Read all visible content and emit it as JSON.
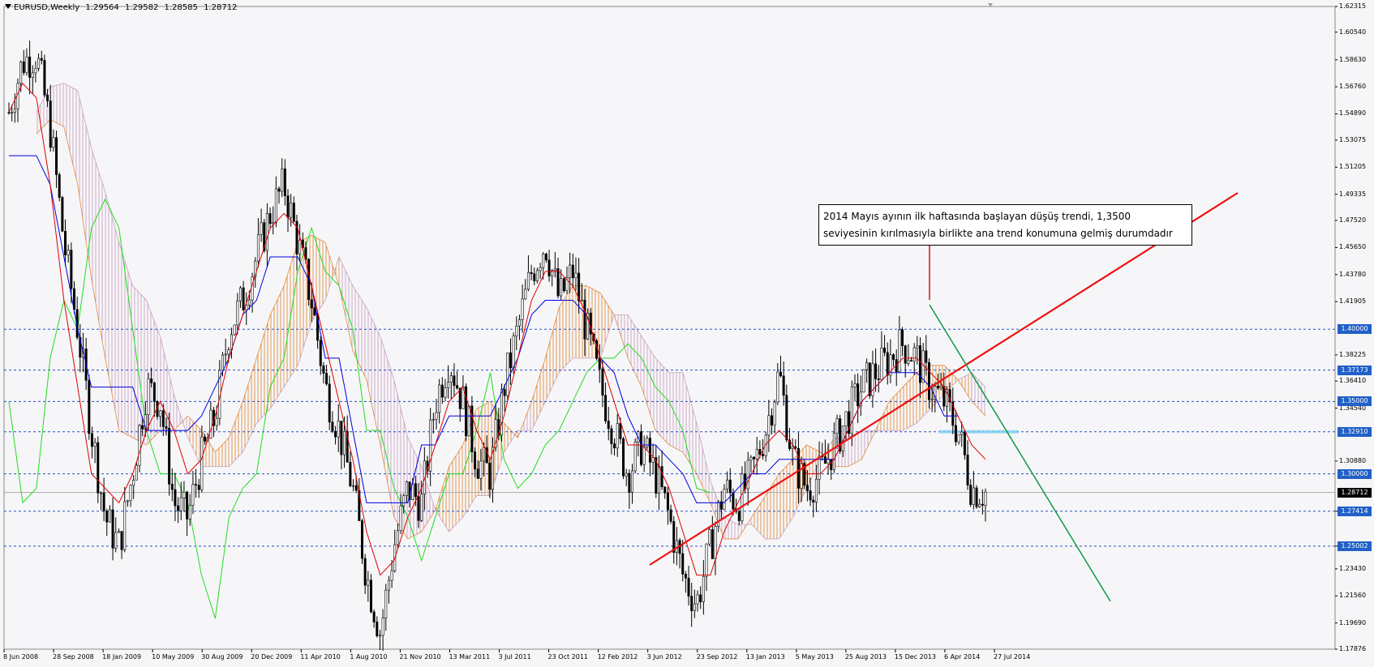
{
  "header": {
    "symbol": "EURUSD,Weekly",
    "open": "1.29564",
    "high": "1.29582",
    "low": "1.28585",
    "close": "1.28712"
  },
  "annotation": {
    "line1": "2014 Mayıs ayının ilk haftasında başlayan düşüş trendi, 1,3500",
    "line2": "seviyesinin kırılmasıyla birlikte ana trend konumuna gelmiş durumdadır"
  },
  "colors": {
    "background": "#f6f6f8",
    "candle": "#000000",
    "tenkan": "#e00000",
    "kijun": "#0000e0",
    "chikou": "#22dd22",
    "kumo_bull": "#e08a3c",
    "kumo_bear": "#c9a0c0",
    "hline": "#2a4fbf",
    "trendline_up": "#ee1111",
    "trendline_down": "#119944",
    "badge": "#2060c8"
  },
  "chart_data": {
    "type": "candlestick",
    "instrument": "EURUSD",
    "timeframe": "Weekly",
    "ylim": [
      1.17876,
      1.62315
    ],
    "y_ticks": [
      "1.62315",
      "1.60540",
      "1.58630",
      "1.56760",
      "1.54890",
      "1.53075",
      "1.51205",
      "1.49335",
      "1.47520",
      "1.45650",
      "1.43780",
      "1.41905",
      "1.38225",
      "1.36410",
      "1.34540",
      "1.30880",
      "1.27415",
      "1.25002",
      "1.23430",
      "1.21560",
      "1.19690",
      "1.17876"
    ],
    "x_ticks": [
      "8 Jun 2008",
      "28 Sep 2008",
      "18 Jan 2009",
      "10 May 2009",
      "30 Aug 2009",
      "20 Dec 2009",
      "11 Apr 2010",
      "1 Aug 2010",
      "21 Nov 2010",
      "13 Mar 2011",
      "3 Jul 2011",
      "23 Oct 2011",
      "12 Feb 2012",
      "3 Jun 2012",
      "23 Sep 2012",
      "13 Jan 2013",
      "5 May 2013",
      "25 Aug 2013",
      "15 Dec 2013",
      "6 Apr 2014",
      "27 Jul 2014"
    ],
    "levels": [
      {
        "label": "1.40000",
        "value": 1.4
      },
      {
        "label": "1.37173",
        "value": 1.37173
      },
      {
        "label": "1.35000",
        "value": 1.35
      },
      {
        "label": "1.32910",
        "value": 1.3291
      },
      {
        "label": "1.30000",
        "value": 1.3
      },
      {
        "label": "1.27414",
        "value": 1.27414
      },
      {
        "label": "1.25002",
        "value": 1.25002
      }
    ],
    "current_price": {
      "label": "1.28712",
      "value": 1.28712
    },
    "path_close": [
      1.55,
      1.585,
      1.59,
      1.54,
      1.46,
      1.4,
      1.33,
      1.27,
      1.25,
      1.3,
      1.36,
      1.35,
      1.28,
      1.27,
      1.31,
      1.34,
      1.4,
      1.42,
      1.45,
      1.48,
      1.5,
      1.46,
      1.42,
      1.36,
      1.33,
      1.29,
      1.23,
      1.19,
      1.25,
      1.29,
      1.28,
      1.35,
      1.38,
      1.35,
      1.31,
      1.3,
      1.36,
      1.4,
      1.44,
      1.46,
      1.42,
      1.44,
      1.4,
      1.36,
      1.33,
      1.3,
      1.32,
      1.3,
      1.27,
      1.23,
      1.21,
      1.25,
      1.29,
      1.28,
      1.3,
      1.33,
      1.37,
      1.31,
      1.29,
      1.3,
      1.32,
      1.34,
      1.36,
      1.37,
      1.38,
      1.39,
      1.38,
      1.36,
      1.35,
      1.33,
      1.29,
      1.287
    ],
    "tenkan": [
      1.55,
      1.57,
      1.56,
      1.5,
      1.42,
      1.36,
      1.3,
      1.29,
      1.28,
      1.3,
      1.33,
      1.35,
      1.33,
      1.3,
      1.31,
      1.34,
      1.38,
      1.41,
      1.44,
      1.47,
      1.48,
      1.47,
      1.43,
      1.39,
      1.35,
      1.31,
      1.26,
      1.23,
      1.24,
      1.27,
      1.29,
      1.32,
      1.35,
      1.36,
      1.33,
      1.31,
      1.34,
      1.38,
      1.42,
      1.44,
      1.44,
      1.43,
      1.41,
      1.38,
      1.35,
      1.32,
      1.32,
      1.31,
      1.29,
      1.26,
      1.23,
      1.23,
      1.26,
      1.28,
      1.3,
      1.32,
      1.33,
      1.32,
      1.3,
      1.3,
      1.31,
      1.33,
      1.35,
      1.36,
      1.37,
      1.38,
      1.38,
      1.37,
      1.36,
      1.34,
      1.32,
      1.31
    ],
    "kijun": [
      1.52,
      1.52,
      1.52,
      1.5,
      1.45,
      1.4,
      1.36,
      1.36,
      1.36,
      1.36,
      1.33,
      1.33,
      1.33,
      1.33,
      1.34,
      1.36,
      1.38,
      1.41,
      1.42,
      1.45,
      1.45,
      1.45,
      1.43,
      1.38,
      1.38,
      1.33,
      1.28,
      1.28,
      1.28,
      1.28,
      1.32,
      1.32,
      1.34,
      1.34,
      1.34,
      1.34,
      1.36,
      1.38,
      1.41,
      1.42,
      1.42,
      1.42,
      1.41,
      1.38,
      1.37,
      1.34,
      1.32,
      1.32,
      1.31,
      1.3,
      1.28,
      1.28,
      1.28,
      1.29,
      1.3,
      1.3,
      1.31,
      1.31,
      1.31,
      1.31,
      1.31,
      1.33,
      1.35,
      1.36,
      1.37,
      1.37,
      1.37,
      1.36,
      1.34,
      1.34
    ],
    "chikou": [
      1.35,
      1.28,
      1.29,
      1.38,
      1.42,
      1.4,
      1.47,
      1.49,
      1.47,
      1.4,
      1.33,
      1.3,
      1.3,
      1.28,
      1.23,
      1.2,
      1.27,
      1.29,
      1.3,
      1.36,
      1.38,
      1.44,
      1.47,
      1.44,
      1.43,
      1.4,
      1.33,
      1.33,
      1.29,
      1.27,
      1.24,
      1.27,
      1.3,
      1.3,
      1.33,
      1.37,
      1.31,
      1.29,
      1.3,
      1.32,
      1.33,
      1.35,
      1.37,
      1.38,
      1.38,
      1.39,
      1.38,
      1.36,
      1.35,
      1.33,
      1.29,
      1.287
    ]
  }
}
